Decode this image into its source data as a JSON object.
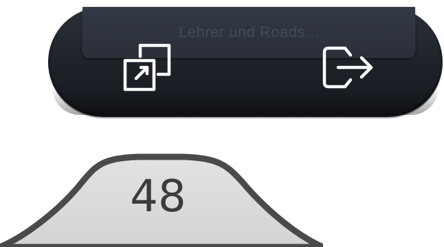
{
  "toolbar": {
    "faded_label": "Lehrer und Roads...",
    "buttons": [
      {
        "id": "switch",
        "icon": "switch-window-icon"
      },
      {
        "id": "logout",
        "icon": "logout-arrow-icon"
      }
    ],
    "colors": {
      "background": "#1e2228",
      "icon_stroke": "#ffffff"
    }
  },
  "page_tab": {
    "number": "48",
    "colors": {
      "fill": "#dadada",
      "border": "#4a4a4a",
      "text": "#3b3b3b"
    }
  }
}
